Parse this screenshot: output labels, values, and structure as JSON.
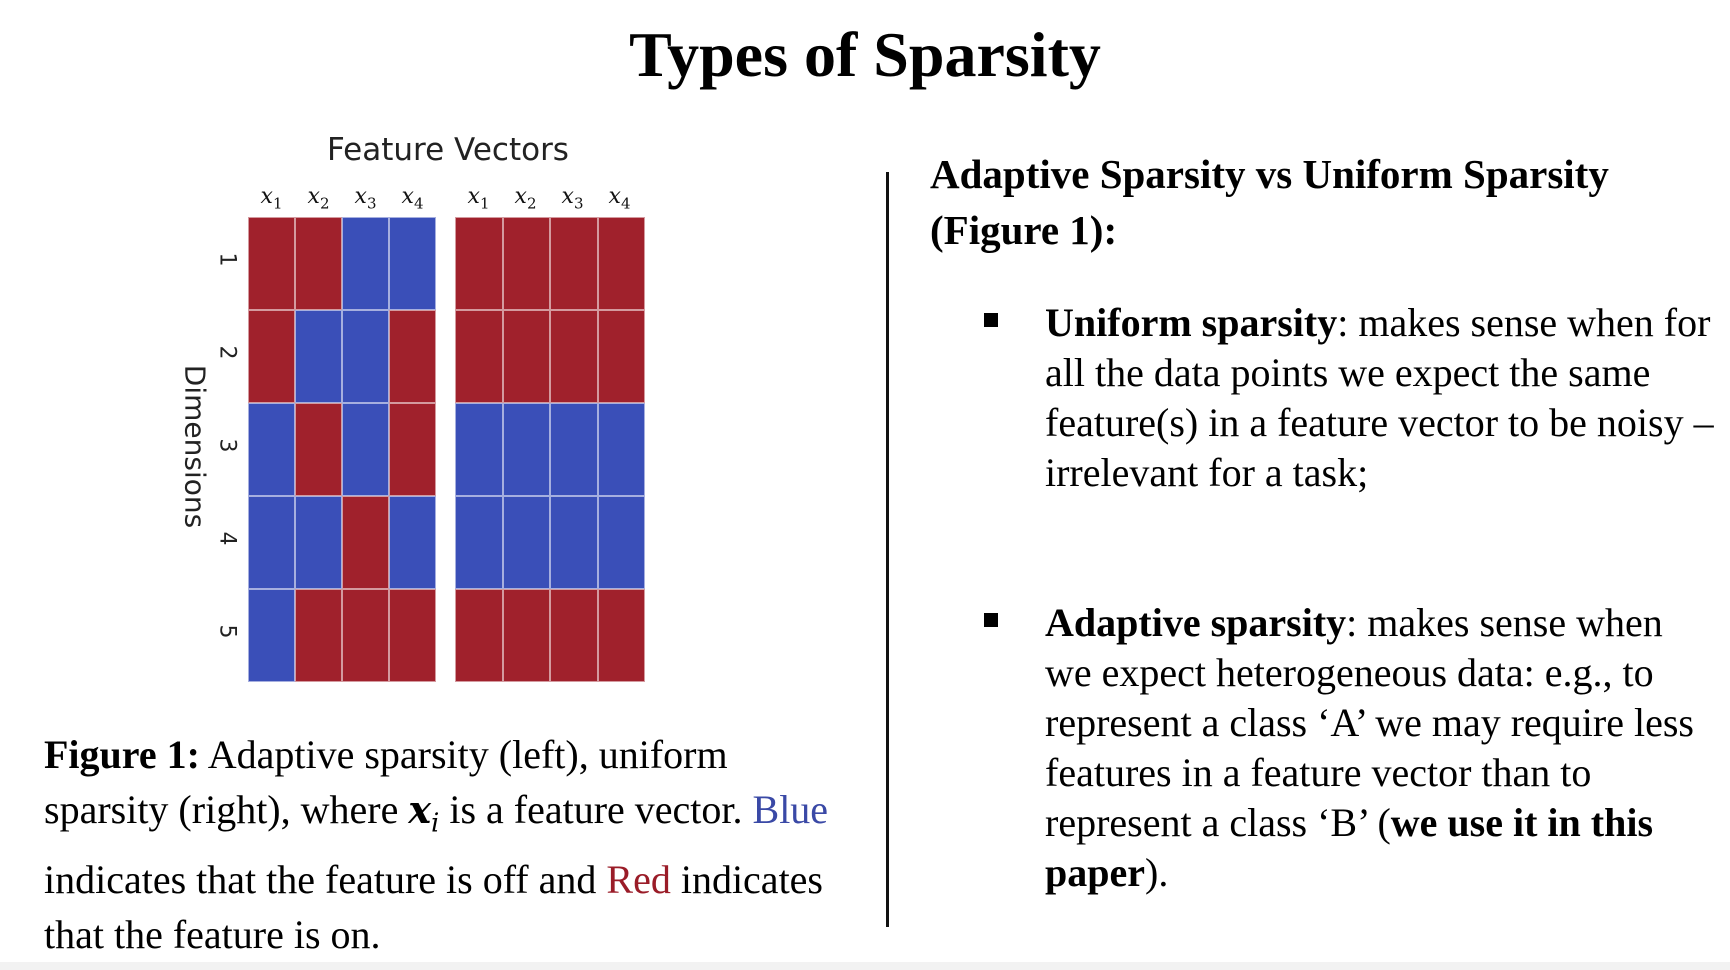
{
  "title": "Types of Sparsity",
  "figure": {
    "title": "Feature Vectors",
    "ylabel": "Dimensions",
    "col_labels": [
      "x",
      "x",
      "x",
      "x"
    ],
    "col_subs": [
      "1",
      "2",
      "3",
      "4"
    ],
    "row_labels": [
      "1",
      "2",
      "3",
      "4",
      "5"
    ],
    "colors": {
      "on": "#a0212c",
      "off": "#3a4fb8"
    },
    "left_grid": [
      [
        "on",
        "on",
        "off",
        "off"
      ],
      [
        "on",
        "off",
        "off",
        "on"
      ],
      [
        "off",
        "on",
        "off",
        "on"
      ],
      [
        "off",
        "off",
        "on",
        "off"
      ],
      [
        "off",
        "on",
        "on",
        "on"
      ]
    ],
    "right_grid": [
      [
        "on",
        "on",
        "on",
        "on"
      ],
      [
        "on",
        "on",
        "on",
        "on"
      ],
      [
        "off",
        "off",
        "off",
        "off"
      ],
      [
        "off",
        "off",
        "off",
        "off"
      ],
      [
        "on",
        "on",
        "on",
        "on"
      ]
    ]
  },
  "caption": {
    "label": "Figure 1:",
    "text1": " Adaptive sparsity (left), uniform sparsity (right), where ",
    "math_var": "x",
    "math_sub": "i",
    "text2": " is a feature vector. ",
    "blue_word": "Blue",
    "text3": " indicates that the feature is off and ",
    "red_word": "Red",
    "text4": " indicates that the feature is on."
  },
  "right": {
    "heading": "Adaptive Sparsity vs Uniform Sparsity (Figure 1):",
    "bullet1_bold": "Uniform sparsity",
    "bullet1_text": ": makes sense when for all the data points we expect the same feature(s) in a feature vector to be noisy – irrelevant for a task;",
    "bullet2_bold": "Adaptive sparsity",
    "bullet2_text": ": makes sense when we expect heterogeneous data: e.g., to represent a class ‘A’ we may require less features in a feature vector than to represent a class ‘B’ (",
    "bullet2_bold2": "we use it in this paper",
    "bullet2_end": ")."
  }
}
